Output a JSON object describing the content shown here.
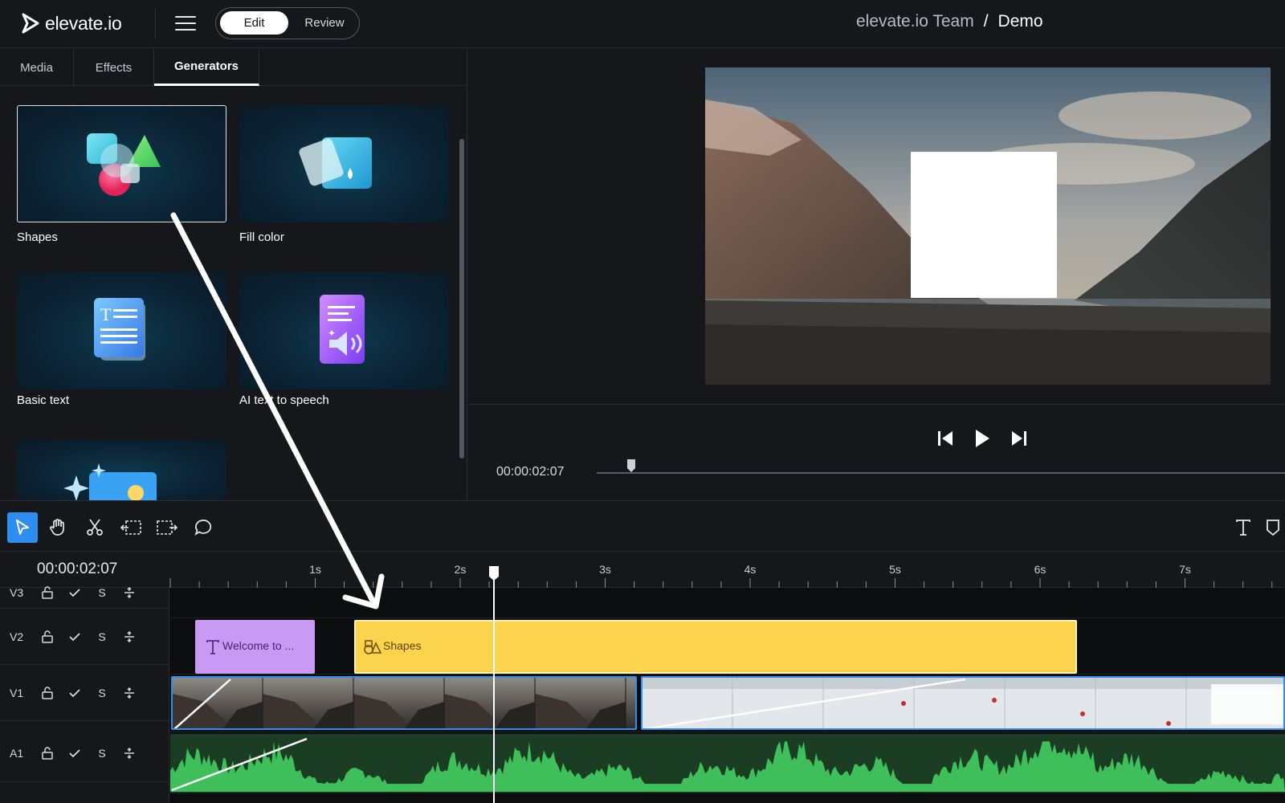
{
  "header": {
    "logo_text": "elevate.io",
    "mode_edit": "Edit",
    "mode_review": "Review",
    "breadcrumb_team": "elevate.io Team",
    "breadcrumb_sep": "/",
    "breadcrumb_project": "Demo"
  },
  "left_panel": {
    "tabs": [
      {
        "label": "Media",
        "active": false
      },
      {
        "label": "Effects",
        "active": false
      },
      {
        "label": "Generators",
        "active": true
      }
    ],
    "generators": [
      {
        "label": "Shapes",
        "icon": "shapes-icon",
        "selected": true
      },
      {
        "label": "Fill color",
        "icon": "fill-bucket-icon",
        "selected": false
      },
      {
        "label": "Basic text",
        "icon": "text-document-icon",
        "selected": false
      },
      {
        "label": "AI text to speech",
        "icon": "speech-icon",
        "selected": false
      },
      {
        "label": "",
        "icon": "ai-image-icon",
        "selected": false
      }
    ]
  },
  "preview": {
    "timecode": "00:00:02:07",
    "scrub_position": 0.05
  },
  "toolbar": {
    "tools": [
      "select-tool",
      "hand-tool",
      "cut-tool",
      "trim-left-tool",
      "trim-right-tool",
      "comment-tool"
    ],
    "right_tools": [
      "text-tool",
      "marker-tool"
    ]
  },
  "timeline": {
    "timecode": "00:00:02:07",
    "ruler_labels": [
      "1s",
      "2s",
      "3s",
      "4s",
      "5s",
      "6s",
      "7s"
    ],
    "tracks": [
      {
        "name": "V3",
        "solo": "S"
      },
      {
        "name": "V2",
        "solo": "S"
      },
      {
        "name": "V1",
        "solo": "S"
      },
      {
        "name": "A1",
        "solo": "S"
      }
    ],
    "clips": {
      "welcome": "Welcome to ...",
      "shapes": "Shapes"
    }
  },
  "colors": {
    "accent": "#2d8ef0",
    "text_clip": "#c99af3",
    "shape_clip": "#fbd34d",
    "audio": "#3fbf5a"
  }
}
